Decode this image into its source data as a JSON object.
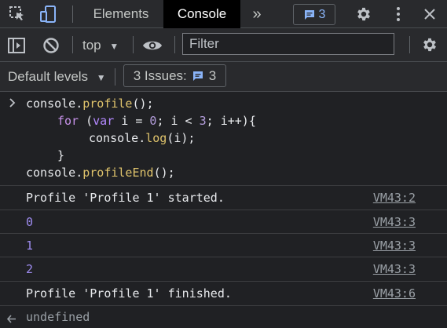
{
  "tabbar": {
    "tabs": [
      {
        "label": "Elements"
      },
      {
        "label": "Console"
      }
    ],
    "more": "»",
    "message_count": "3"
  },
  "toolbar": {
    "context": "top",
    "filter_placeholder": "Filter"
  },
  "levels": {
    "default_levels": "Default levels",
    "issues_label": "3 Issues:",
    "issues_count": "3"
  },
  "input": {
    "lines": [
      {
        "t1": "console.",
        "f1": "profile",
        "t2": "();"
      },
      {
        "kw": "for",
        "t1": " (",
        "kw2": "var",
        "t2": " i = ",
        "n1": "0",
        "t3": "; i < ",
        "n2": "3",
        "t4": "; i++){"
      },
      {
        "t1": "console.",
        "f1": "log",
        "t2": "(i);"
      },
      {
        "t1": "}"
      },
      {
        "t1": "console.",
        "f1": "profileEnd",
        "t2": "();"
      }
    ]
  },
  "messages": [
    {
      "text": "Profile 'Profile 1' started.",
      "source": "VM43:2"
    },
    {
      "text": "0",
      "source": "VM43:3"
    },
    {
      "text": "1",
      "source": "VM43:3"
    },
    {
      "text": "2",
      "source": "VM43:3"
    },
    {
      "text": "Profile 'Profile 1' finished.",
      "source": "VM43:6"
    }
  ],
  "result": "undefined",
  "colors": {
    "background": "#202124",
    "toolbar": "#292a2d",
    "accent_blue": "#8ab4f8",
    "keyword": "#c792ea",
    "function": "#e0c46c",
    "number": "#b39ddb"
  }
}
